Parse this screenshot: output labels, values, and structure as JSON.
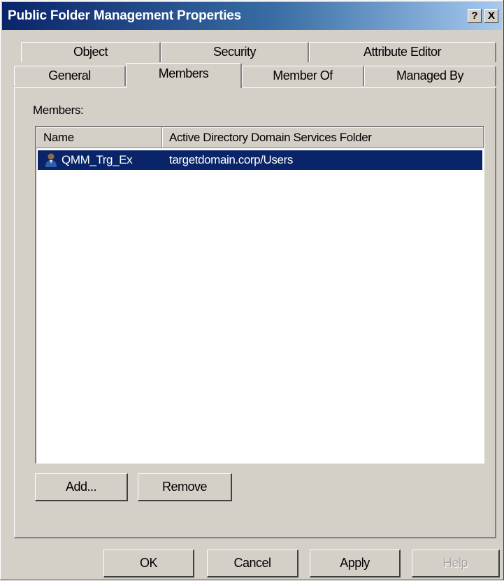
{
  "window": {
    "title": "Public Folder Management Properties",
    "help_button": "?",
    "close_button": "X"
  },
  "tabs": {
    "back_row": [
      "Object",
      "Security",
      "Attribute Editor"
    ],
    "front_row": [
      "General",
      "Members",
      "Member Of",
      "Managed By"
    ],
    "active": "Members"
  },
  "members": {
    "label": "Members:",
    "columns": [
      "Name",
      "Active Directory Domain Services Folder"
    ],
    "rows": [
      {
        "name": "QMM_Trg_Ex",
        "folder": "targetdomain.corp/Users",
        "selected": true,
        "icon": "user-icon"
      }
    ],
    "add_label": "Add...",
    "remove_label": "Remove"
  },
  "footer": {
    "ok_label": "OK",
    "cancel_label": "Cancel",
    "apply_label": "Apply",
    "help_label": "Help"
  },
  "colors": {
    "dialog_face": "#d4d0c8",
    "selection": "#0a246a",
    "titlebar_start": "#0a246a",
    "titlebar_end": "#a6caf0"
  }
}
